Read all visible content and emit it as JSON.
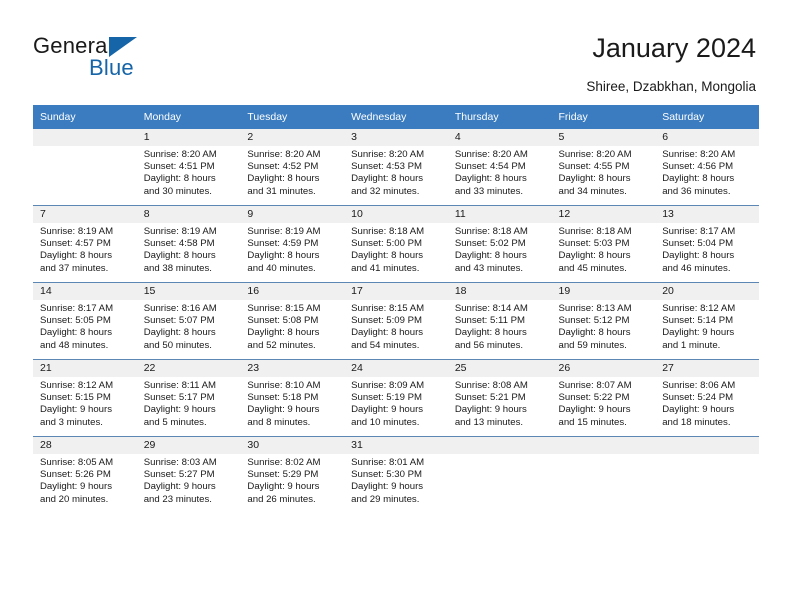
{
  "brand": {
    "name_part1": "General",
    "name_part2": "Blue",
    "triangle_color": "#1565a8",
    "blue_color": "#1565a8"
  },
  "header": {
    "title": "January 2024",
    "subtitle": "Shiree, Dzabkhan, Mongolia"
  },
  "theme": {
    "header_row_bg": "#3b7cc0",
    "header_row_text": "#ffffff",
    "day_band_bg": "#f0f0f0",
    "row_separator": "#5c87b5",
    "body_text": "#1a1a1a"
  },
  "calendar": {
    "weekday_headers": [
      "Sunday",
      "Monday",
      "Tuesday",
      "Wednesday",
      "Thursday",
      "Friday",
      "Saturday"
    ],
    "weeks": [
      [
        {
          "day": "",
          "lines": []
        },
        {
          "day": "1",
          "lines": [
            "Sunrise: 8:20 AM",
            "Sunset: 4:51 PM",
            "Daylight: 8 hours",
            "and 30 minutes."
          ]
        },
        {
          "day": "2",
          "lines": [
            "Sunrise: 8:20 AM",
            "Sunset: 4:52 PM",
            "Daylight: 8 hours",
            "and 31 minutes."
          ]
        },
        {
          "day": "3",
          "lines": [
            "Sunrise: 8:20 AM",
            "Sunset: 4:53 PM",
            "Daylight: 8 hours",
            "and 32 minutes."
          ]
        },
        {
          "day": "4",
          "lines": [
            "Sunrise: 8:20 AM",
            "Sunset: 4:54 PM",
            "Daylight: 8 hours",
            "and 33 minutes."
          ]
        },
        {
          "day": "5",
          "lines": [
            "Sunrise: 8:20 AM",
            "Sunset: 4:55 PM",
            "Daylight: 8 hours",
            "and 34 minutes."
          ]
        },
        {
          "day": "6",
          "lines": [
            "Sunrise: 8:20 AM",
            "Sunset: 4:56 PM",
            "Daylight: 8 hours",
            "and 36 minutes."
          ]
        }
      ],
      [
        {
          "day": "7",
          "lines": [
            "Sunrise: 8:19 AM",
            "Sunset: 4:57 PM",
            "Daylight: 8 hours",
            "and 37 minutes."
          ]
        },
        {
          "day": "8",
          "lines": [
            "Sunrise: 8:19 AM",
            "Sunset: 4:58 PM",
            "Daylight: 8 hours",
            "and 38 minutes."
          ]
        },
        {
          "day": "9",
          "lines": [
            "Sunrise: 8:19 AM",
            "Sunset: 4:59 PM",
            "Daylight: 8 hours",
            "and 40 minutes."
          ]
        },
        {
          "day": "10",
          "lines": [
            "Sunrise: 8:18 AM",
            "Sunset: 5:00 PM",
            "Daylight: 8 hours",
            "and 41 minutes."
          ]
        },
        {
          "day": "11",
          "lines": [
            "Sunrise: 8:18 AM",
            "Sunset: 5:02 PM",
            "Daylight: 8 hours",
            "and 43 minutes."
          ]
        },
        {
          "day": "12",
          "lines": [
            "Sunrise: 8:18 AM",
            "Sunset: 5:03 PM",
            "Daylight: 8 hours",
            "and 45 minutes."
          ]
        },
        {
          "day": "13",
          "lines": [
            "Sunrise: 8:17 AM",
            "Sunset: 5:04 PM",
            "Daylight: 8 hours",
            "and 46 minutes."
          ]
        }
      ],
      [
        {
          "day": "14",
          "lines": [
            "Sunrise: 8:17 AM",
            "Sunset: 5:05 PM",
            "Daylight: 8 hours",
            "and 48 minutes."
          ]
        },
        {
          "day": "15",
          "lines": [
            "Sunrise: 8:16 AM",
            "Sunset: 5:07 PM",
            "Daylight: 8 hours",
            "and 50 minutes."
          ]
        },
        {
          "day": "16",
          "lines": [
            "Sunrise: 8:15 AM",
            "Sunset: 5:08 PM",
            "Daylight: 8 hours",
            "and 52 minutes."
          ]
        },
        {
          "day": "17",
          "lines": [
            "Sunrise: 8:15 AM",
            "Sunset: 5:09 PM",
            "Daylight: 8 hours",
            "and 54 minutes."
          ]
        },
        {
          "day": "18",
          "lines": [
            "Sunrise: 8:14 AM",
            "Sunset: 5:11 PM",
            "Daylight: 8 hours",
            "and 56 minutes."
          ]
        },
        {
          "day": "19",
          "lines": [
            "Sunrise: 8:13 AM",
            "Sunset: 5:12 PM",
            "Daylight: 8 hours",
            "and 59 minutes."
          ]
        },
        {
          "day": "20",
          "lines": [
            "Sunrise: 8:12 AM",
            "Sunset: 5:14 PM",
            "Daylight: 9 hours",
            "and 1 minute."
          ]
        }
      ],
      [
        {
          "day": "21",
          "lines": [
            "Sunrise: 8:12 AM",
            "Sunset: 5:15 PM",
            "Daylight: 9 hours",
            "and 3 minutes."
          ]
        },
        {
          "day": "22",
          "lines": [
            "Sunrise: 8:11 AM",
            "Sunset: 5:17 PM",
            "Daylight: 9 hours",
            "and 5 minutes."
          ]
        },
        {
          "day": "23",
          "lines": [
            "Sunrise: 8:10 AM",
            "Sunset: 5:18 PM",
            "Daylight: 9 hours",
            "and 8 minutes."
          ]
        },
        {
          "day": "24",
          "lines": [
            "Sunrise: 8:09 AM",
            "Sunset: 5:19 PM",
            "Daylight: 9 hours",
            "and 10 minutes."
          ]
        },
        {
          "day": "25",
          "lines": [
            "Sunrise: 8:08 AM",
            "Sunset: 5:21 PM",
            "Daylight: 9 hours",
            "and 13 minutes."
          ]
        },
        {
          "day": "26",
          "lines": [
            "Sunrise: 8:07 AM",
            "Sunset: 5:22 PM",
            "Daylight: 9 hours",
            "and 15 minutes."
          ]
        },
        {
          "day": "27",
          "lines": [
            "Sunrise: 8:06 AM",
            "Sunset: 5:24 PM",
            "Daylight: 9 hours",
            "and 18 minutes."
          ]
        }
      ],
      [
        {
          "day": "28",
          "lines": [
            "Sunrise: 8:05 AM",
            "Sunset: 5:26 PM",
            "Daylight: 9 hours",
            "and 20 minutes."
          ]
        },
        {
          "day": "29",
          "lines": [
            "Sunrise: 8:03 AM",
            "Sunset: 5:27 PM",
            "Daylight: 9 hours",
            "and 23 minutes."
          ]
        },
        {
          "day": "30",
          "lines": [
            "Sunrise: 8:02 AM",
            "Sunset: 5:29 PM",
            "Daylight: 9 hours",
            "and 26 minutes."
          ]
        },
        {
          "day": "31",
          "lines": [
            "Sunrise: 8:01 AM",
            "Sunset: 5:30 PM",
            "Daylight: 9 hours",
            "and 29 minutes."
          ]
        },
        {
          "day": "",
          "lines": []
        },
        {
          "day": "",
          "lines": []
        },
        {
          "day": "",
          "lines": []
        }
      ]
    ]
  }
}
